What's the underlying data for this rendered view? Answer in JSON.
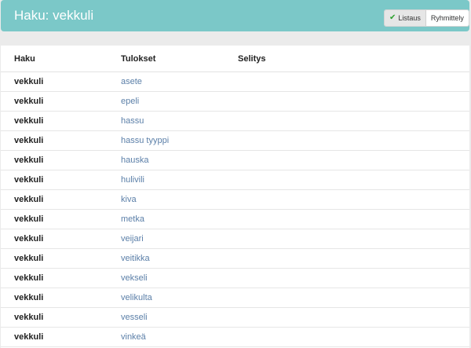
{
  "header": {
    "title": "Haku: vekkuli",
    "view_listaus": "Listaus",
    "view_ryhmittely": "Ryhmittely"
  },
  "table": {
    "columns": [
      "Haku",
      "Tulokset",
      "Selitys"
    ],
    "rows": [
      {
        "query": "vekkuli",
        "result": "asete",
        "explanation": ""
      },
      {
        "query": "vekkuli",
        "result": "epeli",
        "explanation": ""
      },
      {
        "query": "vekkuli",
        "result": "hassu",
        "explanation": ""
      },
      {
        "query": "vekkuli",
        "result": "hassu tyyppi",
        "explanation": ""
      },
      {
        "query": "vekkuli",
        "result": "hauska",
        "explanation": ""
      },
      {
        "query": "vekkuli",
        "result": "hulivili",
        "explanation": ""
      },
      {
        "query": "vekkuli",
        "result": "kiva",
        "explanation": ""
      },
      {
        "query": "vekkuli",
        "result": "metka",
        "explanation": ""
      },
      {
        "query": "vekkuli",
        "result": "veijari",
        "explanation": ""
      },
      {
        "query": "vekkuli",
        "result": "veitikka",
        "explanation": ""
      },
      {
        "query": "vekkuli",
        "result": "vekseli",
        "explanation": ""
      },
      {
        "query": "vekkuli",
        "result": "velikulta",
        "explanation": ""
      },
      {
        "query": "vekkuli",
        "result": "vesseli",
        "explanation": ""
      },
      {
        "query": "vekkuli",
        "result": "vinkeä",
        "explanation": ""
      }
    ]
  },
  "colors": {
    "header_bg": "#7bc8c8",
    "link": "#5b7fa8",
    "check": "#2ca02c"
  },
  "icons": {
    "listaus_icon": "check-icon"
  }
}
